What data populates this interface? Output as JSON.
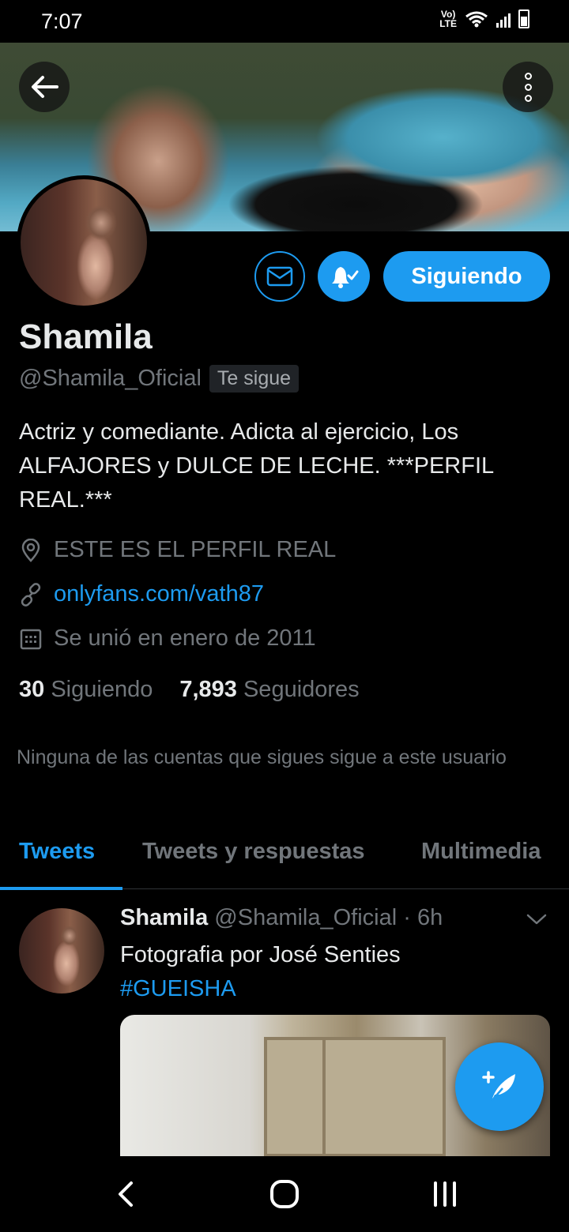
{
  "status_bar": {
    "time": "7:07",
    "network_label_top": "Vo)",
    "network_label_bottom": "LTE"
  },
  "header": {
    "back_icon": "arrow-left-icon",
    "more_icon": "vertical-dots-icon"
  },
  "profile": {
    "display_name": "Shamila",
    "handle": "@Shamila_Oficial",
    "follows_you_badge": "Te sigue",
    "follow_button_label": "Siguiendo",
    "bio": "Actriz y comediante. Adicta al ejercicio, Los ALFAJORES y DULCE DE LECHE. ***PERFIL REAL.***",
    "location": "ESTE ES EL PERFIL REAL",
    "website": "onlyfans.com/vath87",
    "joined": "Se unió en enero de 2011",
    "following_count": "30",
    "following_label": "Siguiendo",
    "followers_count": "7,893",
    "followers_label": "Seguidores",
    "mutuals_note": "Ninguna de las cuentas que sigues sigue a este usuario"
  },
  "tabs": [
    {
      "label": "Tweets",
      "active": true
    },
    {
      "label": "Tweets y respuestas",
      "active": false
    },
    {
      "label": "Multimedia",
      "active": false
    }
  ],
  "tweet": {
    "name": "Shamila",
    "handle": "@Shamila_Oficial",
    "separator": " · ",
    "time": "6h",
    "text": "Fotografia por José Senties",
    "hashtag": "#GUEISHA"
  },
  "colors": {
    "accent": "#1d9bf0",
    "background": "#000000",
    "secondary_text": "#71767b"
  }
}
